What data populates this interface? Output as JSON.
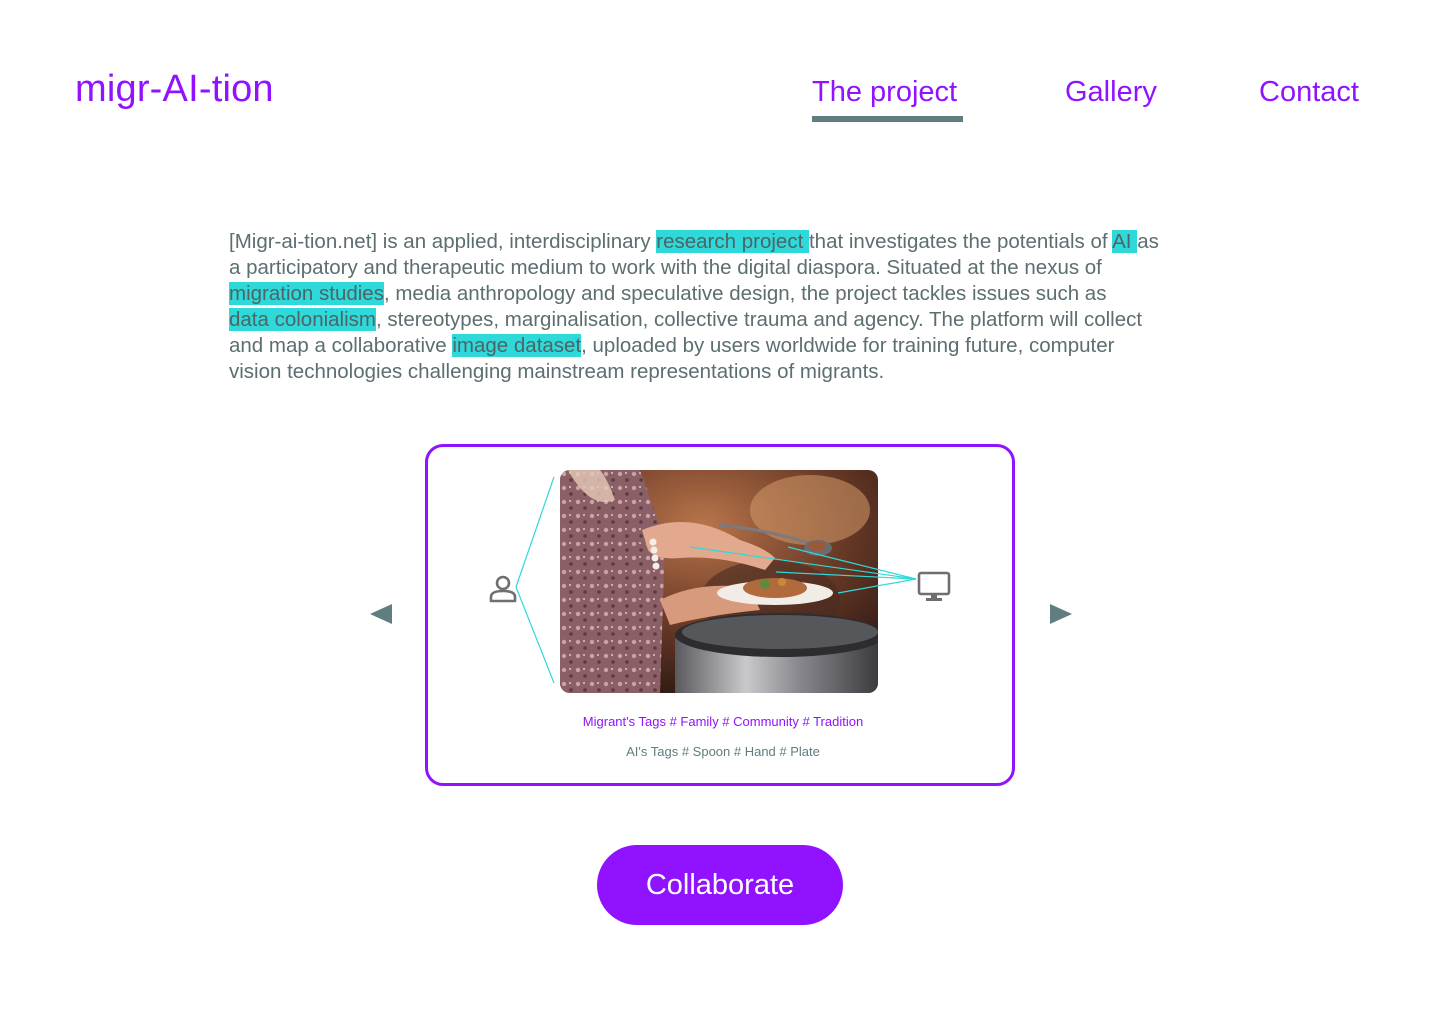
{
  "header": {
    "logo": "migr-AI-tion",
    "nav": [
      {
        "label": "The project",
        "active": true
      },
      {
        "label": "Gallery",
        "active": false
      },
      {
        "label": "Contact",
        "active": false
      }
    ]
  },
  "intro": {
    "lines": [
      [
        "[Migr-ai-tion.net] is an applied, interdisciplinary ",
        {
          "hl": "research project "
        },
        "that investigates the potentials of ",
        {
          "hl": "AI "
        },
        "as"
      ],
      [
        "a participatory and therapeutic medium to work with the digital diaspora. Situated at the nexus of"
      ],
      [
        {
          "hl": "migration studies"
        },
        ", media anthropology and speculative design, the project tackles issues such as"
      ],
      [
        {
          "hl": "data colonialism"
        },
        ", stereotypes, marginalisation, collective trauma and agency. The platform will collect"
      ],
      [
        "and map a collaborative ",
        {
          "hl": "image dataset"
        },
        ", uploaded by users worldwide for training future, computer"
      ],
      [
        "vision technologies challenging mainstream representations of migrants."
      ]
    ]
  },
  "carousel": {
    "image_alt": "Person serving food from a pot onto a plate",
    "migrant_tags": "Migrant's Tags # Family # Community # Tradition",
    "ai_tags": "AI's Tags # Spoon # Hand # Plate",
    "prev_icon": "triangle-left-icon",
    "next_icon": "triangle-right-icon",
    "user_icon": "person-icon",
    "ai_icon": "monitor-icon"
  },
  "cta": {
    "label": "Collaborate"
  },
  "colors": {
    "brand": "#9012fe",
    "highlight": "#2fd9d9",
    "text": "#5c6e70",
    "accent_gray": "#607d7f"
  }
}
